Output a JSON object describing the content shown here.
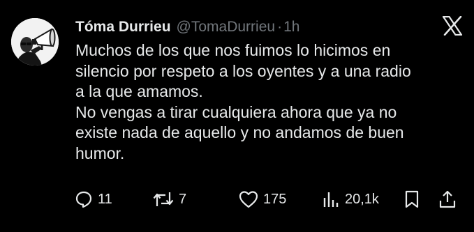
{
  "tweet": {
    "display_name": "Tóma Durrieu",
    "handle": "@TomaDurrieu",
    "separator": "·",
    "time": "1h",
    "text": "Muchos de los que nos fuimos lo hicimos en\nsilencio por respeto a los oyentes y a una radio\na la que amamos.\nNo vengas a tirar cualquiera ahora que ya no\nexiste nada de aquello y no andamos de buen\nhumor."
  },
  "stats": {
    "replies": "11",
    "reposts": "7",
    "likes": "175",
    "views": "20,1k"
  },
  "icons": {
    "brand": "x-logo-icon",
    "reply": "reply-icon",
    "repost": "repost-icon",
    "like": "heart-icon",
    "views": "views-icon",
    "bookmark": "bookmark-icon",
    "share": "share-icon"
  },
  "colors": {
    "background": "#000000",
    "text": "#e7e9ea",
    "secondary": "#71767b"
  }
}
